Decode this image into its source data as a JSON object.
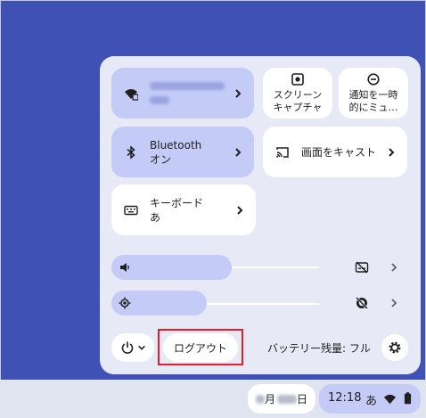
{
  "quick_settings": {
    "network": {
      "label_blurred": true
    },
    "screen_capture": {
      "line1": "スクリーン",
      "line2": "キャプチャ"
    },
    "do_not_disturb": {
      "line1": "通知を一時",
      "line2": "的にミュ…"
    },
    "bluetooth": {
      "title": "Bluetooth",
      "status": "オン"
    },
    "cast": {
      "label": "画面をキャスト"
    },
    "keyboard": {
      "title": "キーボード",
      "status": "あ"
    },
    "volume": {
      "level": 0.58
    },
    "brightness": {
      "level": 0.46
    },
    "logout": {
      "label": "ログアウト"
    },
    "battery": {
      "label": "バッテリー残量: フル"
    }
  },
  "shelf": {
    "date": {
      "month_suffix": "月",
      "day_suffix": "日"
    },
    "status": {
      "time": "12:18",
      "ime": "あ"
    }
  },
  "colors": {
    "desktop": "#3f51b5",
    "panel": "#e7e9f6",
    "active_tile": "#c4cbf6",
    "highlight": "#e41e2a"
  },
  "icons": [
    "wifi-lock-icon",
    "screen-capture-icon",
    "do-not-disturb-icon",
    "bluetooth-icon",
    "cast-icon",
    "keyboard-icon",
    "volume-icon",
    "brightness-icon",
    "mute-captions-icon",
    "privacy-screen-icon",
    "power-icon",
    "settings-icon",
    "wifi-icon",
    "battery-icon"
  ]
}
